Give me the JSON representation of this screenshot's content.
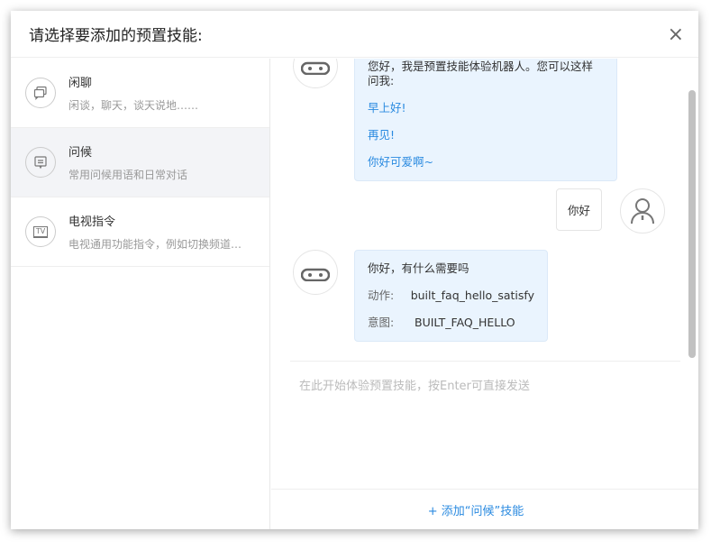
{
  "dialog": {
    "title": "请选择要添加的预置技能:",
    "close": "×"
  },
  "skills": [
    {
      "name": "闲聊",
      "desc": "闲谈，聊天，谈天说地……",
      "icon": "chat-icon"
    },
    {
      "name": "问候",
      "desc": "常用问候用语和日常对话",
      "icon": "message-icon",
      "active": true
    },
    {
      "name": "电视指令",
      "desc": "电视通用功能指令，例如切换频道…",
      "icon": "tv-icon",
      "icon_text": "TV"
    }
  ],
  "chat": {
    "bot_intro": "您好，我是预置技能体验机器人。您可以这样问我:",
    "suggestions": [
      "早上好!",
      "再见!",
      "你好可爱啊~"
    ],
    "user_msg": "你好",
    "bot_reply": "你好，有什么需要吗",
    "action_label": "动作:",
    "action_value": "built_faq_hello_satisfy",
    "intent_label": "意图:",
    "intent_value": "BUILT_FAQ_HELLO",
    "input_placeholder": "在此开始体验预置技能，按Enter可直接发送"
  },
  "footer": {
    "add_button": "+ 添加“问候”技能"
  }
}
